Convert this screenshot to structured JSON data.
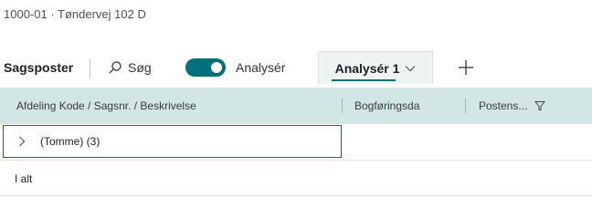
{
  "breadcrumb": "1000-01 · Tøndervej 102 D",
  "toolbar": {
    "title": "Sagsposter",
    "search_label": "Søg",
    "analyse_label": "Analysér",
    "analyse_toggle_on": true,
    "tab_label": "Analysér 1",
    "add_icon": "plus-icon"
  },
  "grid": {
    "columns": [
      "Afdeling Kode / Sagsnr. / Beskrivelse",
      "Bogføringsda",
      "Postens..."
    ],
    "group_row": "(Tomme) (3)",
    "total_row": "I alt"
  },
  "colors": {
    "accent": "#00707a",
    "header_bg": "#d3e6e6"
  }
}
